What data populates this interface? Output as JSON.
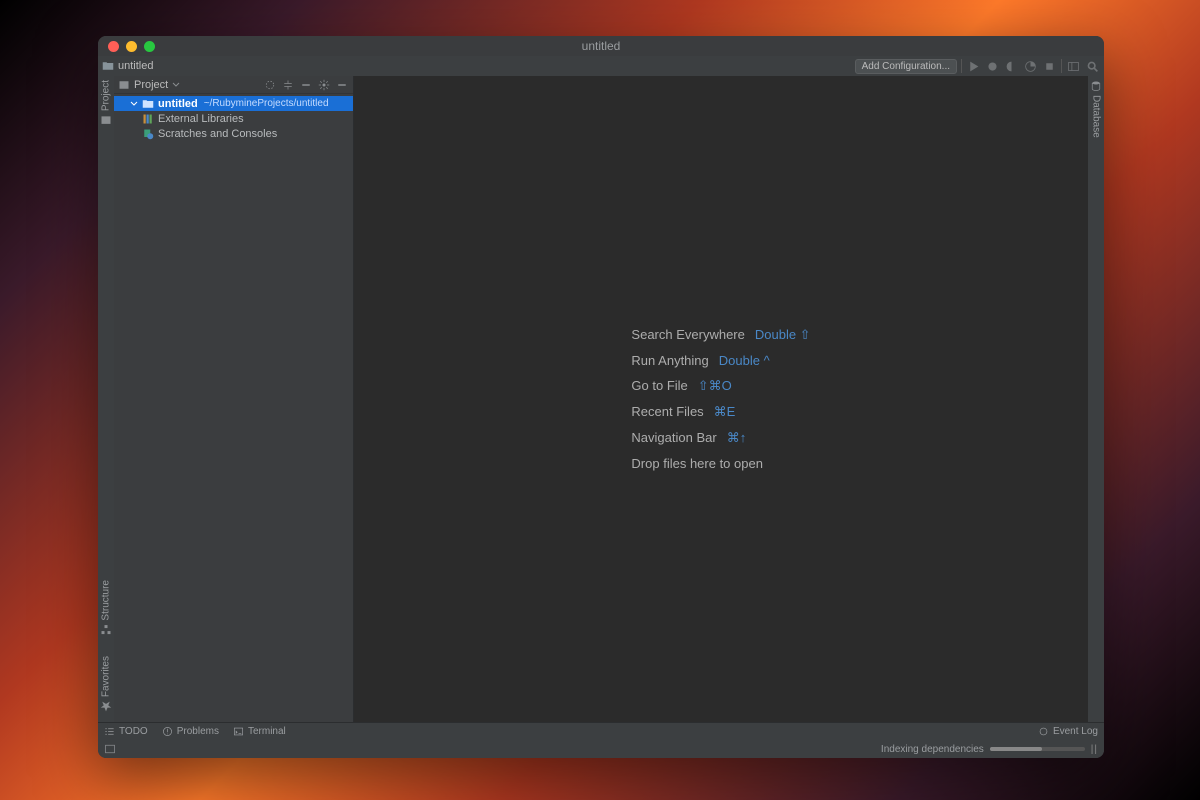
{
  "titlebar": {
    "title": "untitled"
  },
  "toolbar": {
    "breadcrumb_icon": "folder",
    "breadcrumb": "untitled",
    "add_config": "Add Configuration..."
  },
  "left_tabs": {
    "project": "Project",
    "structure": "Structure",
    "favorites": "Favorites"
  },
  "right_tabs": {
    "database": "Database"
  },
  "sidebar": {
    "header": "Project",
    "tree": {
      "root_name": "untitled",
      "root_path": "~/RubymineProjects/untitled",
      "ext_lib": "External Libraries",
      "scratches": "Scratches and Consoles"
    }
  },
  "welcome": {
    "rows": [
      {
        "label": "Search Everywhere",
        "key": "Double ⇧"
      },
      {
        "label": "Run Anything",
        "key": "Double ^"
      },
      {
        "label": "Go to File",
        "key": "⇧⌘O"
      },
      {
        "label": "Recent Files",
        "key": "⌘E"
      },
      {
        "label": "Navigation Bar",
        "key": "⌘↑"
      },
      {
        "label": "Drop files here to open",
        "key": ""
      }
    ]
  },
  "bottom": {
    "todo": "TODO",
    "problems": "Problems",
    "terminal": "Terminal",
    "event_log": "Event Log"
  },
  "status": {
    "text": "Indexing dependencies"
  }
}
